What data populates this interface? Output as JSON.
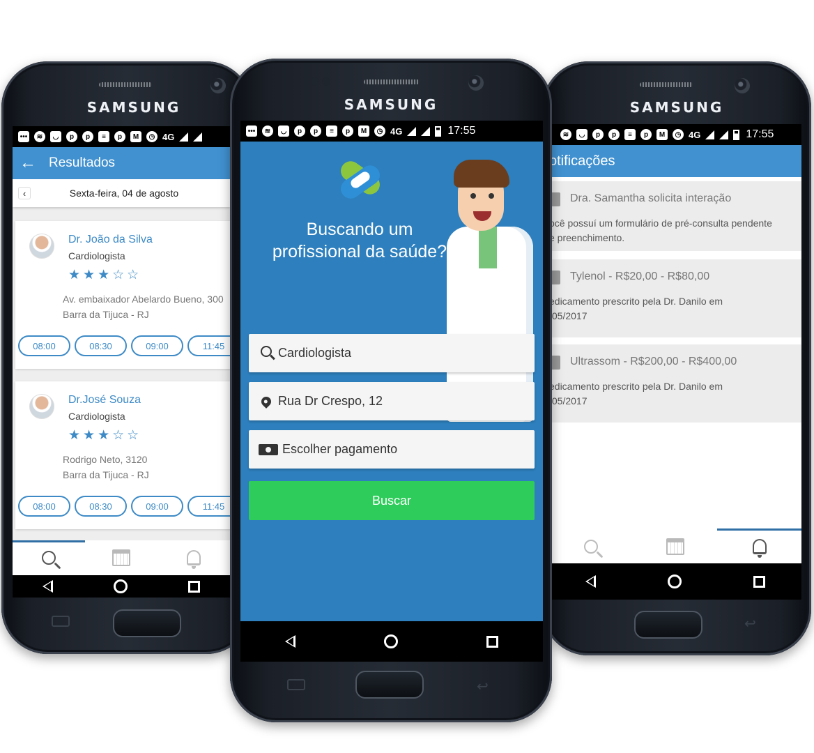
{
  "device": {
    "brand": "SAMSUNG"
  },
  "status_bar": {
    "network": "4G",
    "time": "17:55"
  },
  "left_screen": {
    "title": "Resultados",
    "date_label": "Sexta-feira, 04 de agosto",
    "doctors": [
      {
        "name": "Dr. João da Silva",
        "specialty": "Cardiologista",
        "stars": "★★★☆☆",
        "address_line1": "Av. embaixador Abelardo Bueno, 300",
        "address_line2": "Barra da Tijuca - RJ",
        "slots": [
          "08:00",
          "08:30",
          "09:00",
          "11:45"
        ]
      },
      {
        "name": "Dr.José Souza",
        "specialty": "Cardiologista",
        "stars": "★★★☆☆",
        "address_line1": "Rodrigo Neto, 3120",
        "address_line2": "Barra da Tijuca - RJ",
        "slots": [
          "08:00",
          "08:30",
          "09:00",
          "11:45"
        ]
      }
    ]
  },
  "center_screen": {
    "headline_line1": "Buscando um",
    "headline_line2": "profissional da saúde?",
    "specialty_value": "Cardiologista",
    "address_value": "Rua Dr Crespo, 12",
    "payment_value": "Escolher pagamento",
    "search_button": "Buscar"
  },
  "right_screen": {
    "title": "otificações",
    "notifications": [
      {
        "title": "Dra. Samantha solicita interação",
        "body_line1": "ocê possuí um formulário de pré-consulta pendente",
        "body_line2": "e preenchimento."
      },
      {
        "title": "Tylenol - R$20,00 - R$80,00",
        "body_line1": "edicamento prescrito pela Dr. Danilo em",
        "body_line2": "/05/2017"
      },
      {
        "title": "Ultrassom - R$200,00 - R$400,00",
        "body_line1": "edicamento prescrito pela Dr. Danilo em",
        "body_line2": "/05/2017"
      }
    ]
  },
  "colors": {
    "app_blue": "#4191d0",
    "hero_blue": "#2d7fbd",
    "accent_green": "#2ecc5b",
    "link_blue": "#3d8ac6"
  },
  "icons": [
    "search-icon",
    "calendar-icon",
    "bell-icon",
    "back-arrow-icon",
    "location-pin-icon",
    "cash-icon"
  ]
}
